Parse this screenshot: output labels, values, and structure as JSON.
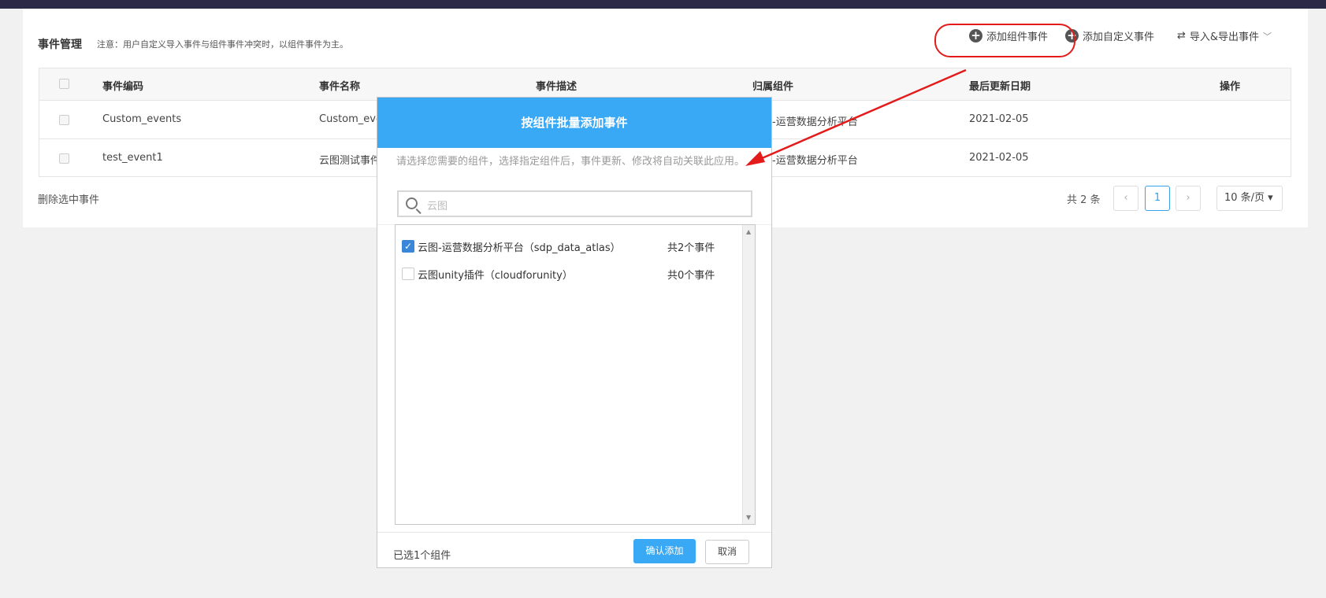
{
  "page": {
    "title": "事件管理",
    "note": "注意：用户自定义导入事件与组件事件冲突时，以组件事件为主。",
    "actions": {
      "add_component": "添加组件事件",
      "add_custom": "添加自定义事件",
      "import_export": "导入&导出事件",
      "swap_icon": "⇄",
      "chevron": "﹀"
    }
  },
  "table": {
    "headers": [
      "事件编码",
      "事件名称",
      "事件描述",
      "归属组件",
      "最后更新日期",
      "操作"
    ],
    "rows": [
      {
        "code": "Custom_events",
        "name": "Custom_eve",
        "component": "-运营数据分析平台",
        "date": "2021-02-05"
      },
      {
        "code": "test_event1",
        "name": "云图测试事件",
        "component": "-运营数据分析平台",
        "date": "2021-02-05"
      }
    ]
  },
  "footer": {
    "delete_selected": "删除选中事件",
    "total": "共 2 条",
    "prev": "‹",
    "page": "1",
    "next": "›",
    "page_size": "10 条/页 ▾"
  },
  "modal": {
    "title": "按组件批量添加事件",
    "hint": "请选择您需要的组件，选择指定组件后，事件更新、修改将自动关联此应用。",
    "search_value": "云图",
    "items": [
      {
        "name": "云图-运营数据分析平台（sdp_data_atlas）",
        "count": "共2个事件",
        "checked": true
      },
      {
        "name": "云图unity插件（cloudforunity）",
        "count": "共0个事件",
        "checked": false
      }
    ],
    "selected_count": "已选1个组件",
    "confirm": "确认添加",
    "cancel": "取消",
    "check_mark": "✓"
  },
  "colors": {
    "modal_header": "#3aa9f5",
    "annotation_red": "#e31b1b",
    "topbar": "#2b2946"
  }
}
